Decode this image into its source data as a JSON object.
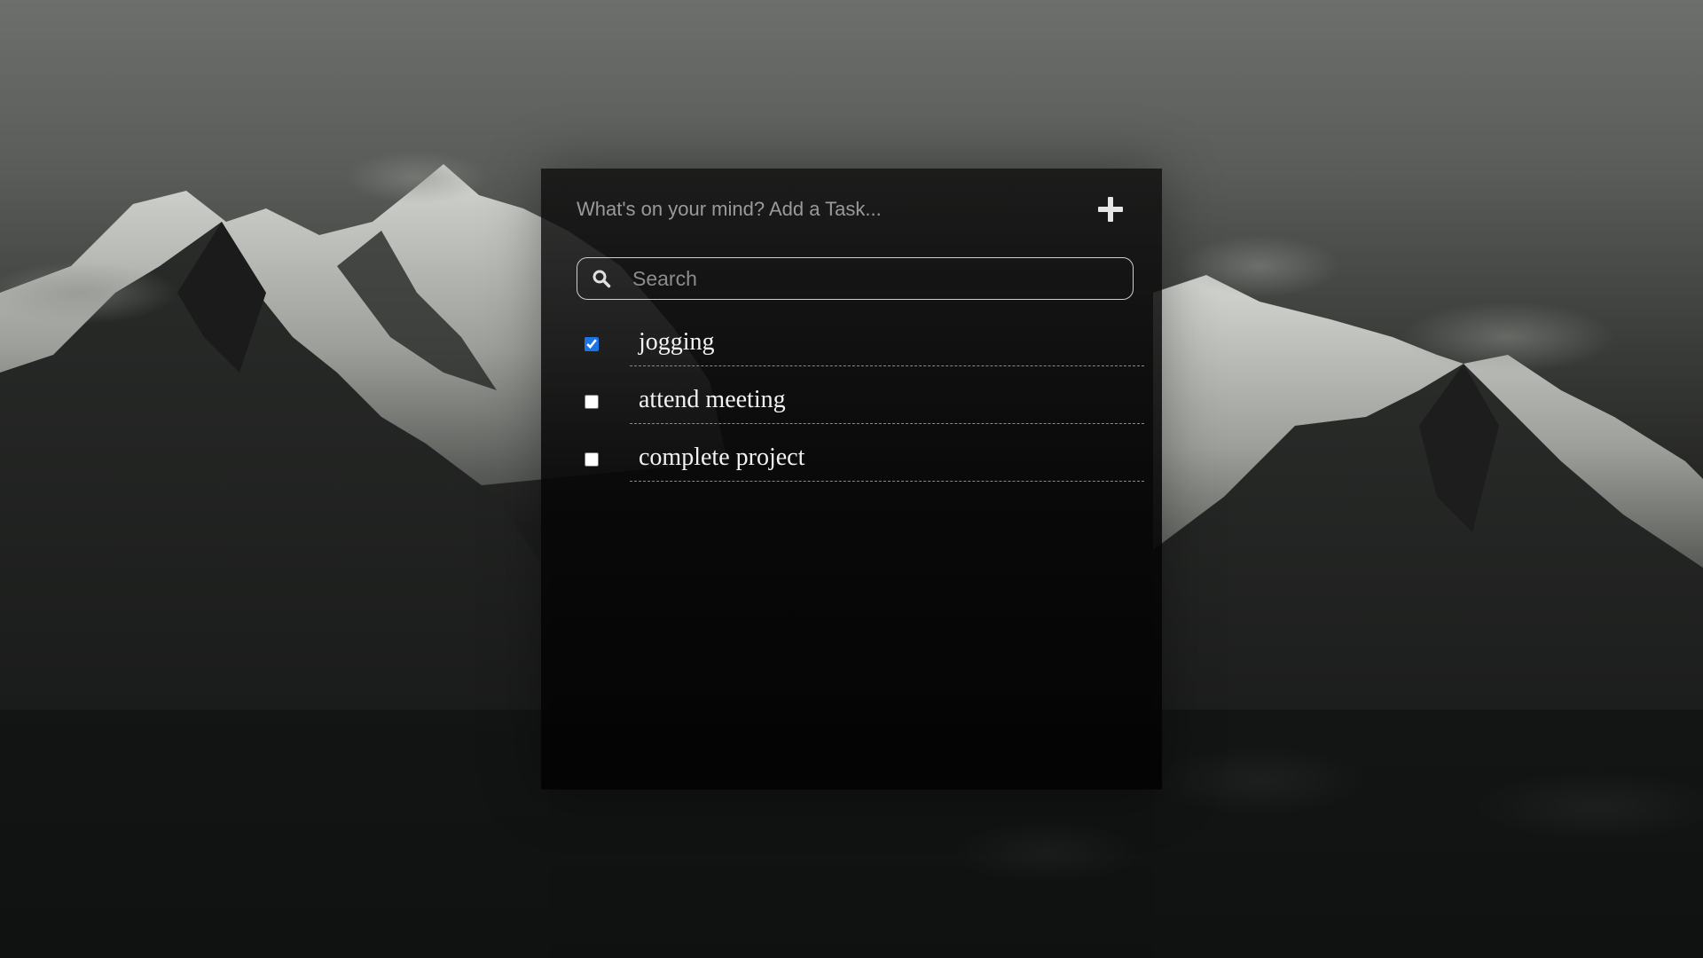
{
  "add_task": {
    "placeholder": "What's on your mind? Add a Task...",
    "value": "",
    "button_icon": "plus-icon"
  },
  "search": {
    "placeholder": "Search",
    "value": "",
    "icon": "search-icon"
  },
  "tasks": [
    {
      "label": "jogging",
      "checked": true
    },
    {
      "label": "attend meeting",
      "checked": false
    },
    {
      "label": "complete project",
      "checked": false
    }
  ],
  "colors": {
    "panel": "#0a0a0a",
    "text": "#f2f2f2",
    "checkbox_accent": "#1a73e8",
    "search_border": "#cfcfcf"
  }
}
